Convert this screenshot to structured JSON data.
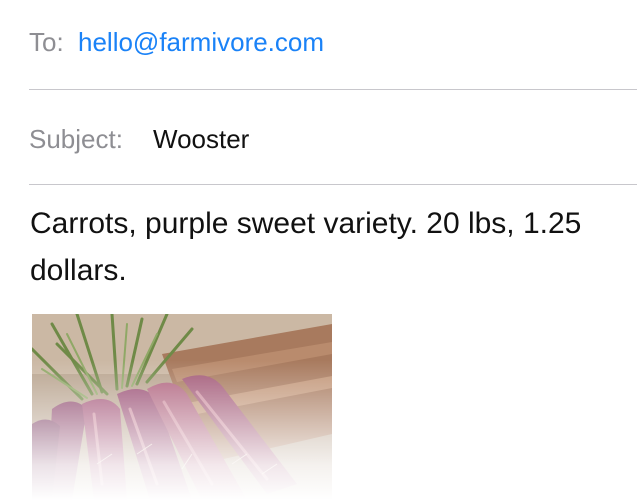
{
  "compose": {
    "to_label": "To:",
    "to_value": "hello@farmivore.com",
    "subject_label": "Subject:",
    "subject_value": "Wooster",
    "body": "Carrots, purple sweet variety. 20 lbs, 1.25 dollars."
  },
  "colors": {
    "link": "#1a82f7",
    "label": "#8e8e93",
    "separator": "#c8c7cc"
  }
}
